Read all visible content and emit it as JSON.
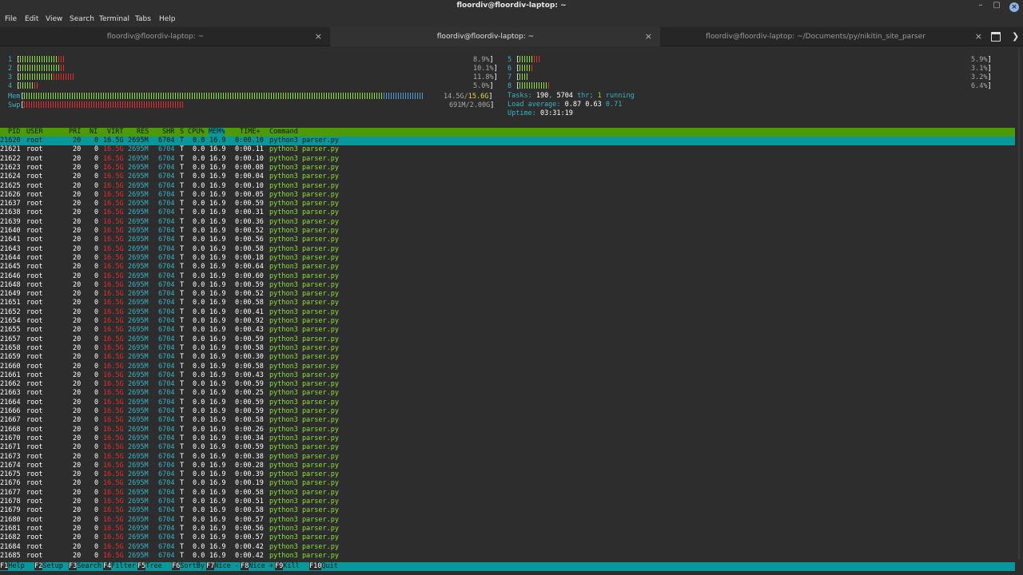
{
  "window": {
    "title": "floordiv@floordiv-laptop: ~",
    "minimize": "–",
    "maximize": "▢",
    "close": "×"
  },
  "menu": [
    "File",
    "Edit",
    "View",
    "Search",
    "Terminal",
    "Tabs",
    "Help"
  ],
  "tabs": [
    {
      "label": "floordiv@floordiv-laptop: ~",
      "close": "×",
      "active": false
    },
    {
      "label": "floordiv@floordiv-laptop: ~",
      "close": "×",
      "active": true
    },
    {
      "label": "floordiv@floordiv-laptop: ~/Documents/py/nikitin_site_parser",
      "close": "×",
      "active": false
    }
  ],
  "htop": {
    "cpus_left": [
      {
        "num": "1",
        "pct": "8.9%",
        "green": 16,
        "red": 3
      },
      {
        "num": "2",
        "pct": "10.1%",
        "green": 17,
        "red": 2
      },
      {
        "num": "3",
        "pct": "11.8%",
        "green": 14,
        "red": 9
      },
      {
        "num": "4",
        "pct": "5.0%",
        "green": 6,
        "red": 2
      }
    ],
    "cpus_right": [
      {
        "num": "5",
        "pct": "5.9%",
        "green": 6,
        "red": 3
      },
      {
        "num": "6",
        "pct": "3.1%",
        "green": 5,
        "red": 1
      },
      {
        "num": "7",
        "pct": "3.2%",
        "green": 4,
        "red": 0
      },
      {
        "num": "8",
        "pct": "6.4%",
        "green": 12,
        "red": 1
      }
    ],
    "mem": {
      "label": "Mem",
      "used": "14.5G",
      "total": "15.6G"
    },
    "swp": {
      "label": "Swp",
      "used": "691M",
      "total": "2.00G"
    },
    "tasks": {
      "label": "Tasks:",
      "count": "190",
      "threads": "5704",
      "thr_label": "thr;",
      "running": "1",
      "running_label": "running"
    },
    "load": {
      "label": "Load average:",
      "l1": "0.87",
      "l5": "0.63",
      "l15": "0.71"
    },
    "uptime": {
      "label": "Uptime:",
      "value": "03:31:19"
    },
    "columns": [
      "PID",
      "USER",
      "PRI",
      "NI",
      "VIRT",
      "RES",
      "SHR",
      "S",
      "CPU%",
      "MEM%",
      "TIME+",
      "Command"
    ],
    "processes": [
      [
        "21620",
        "root",
        "20",
        "0",
        "16.5G",
        "2695M",
        "6704",
        "T",
        "0.0",
        "16.9",
        "0:00.10",
        "python3 parser.py"
      ],
      [
        "21621",
        "root",
        "20",
        "0",
        "16.5G",
        "2695M",
        "6704",
        "T",
        "0.0",
        "16.9",
        "0:00.11",
        "python3 parser.py"
      ],
      [
        "21622",
        "root",
        "20",
        "0",
        "16.5G",
        "2695M",
        "6704",
        "T",
        "0.0",
        "16.9",
        "0:00.10",
        "python3 parser.py"
      ],
      [
        "21623",
        "root",
        "20",
        "0",
        "16.5G",
        "2695M",
        "6704",
        "T",
        "0.0",
        "16.9",
        "0:00.08",
        "python3 parser.py"
      ],
      [
        "21624",
        "root",
        "20",
        "0",
        "16.5G",
        "2695M",
        "6704",
        "T",
        "0.0",
        "16.9",
        "0:00.04",
        "python3 parser.py"
      ],
      [
        "21625",
        "root",
        "20",
        "0",
        "16.5G",
        "2695M",
        "6704",
        "T",
        "0.0",
        "16.9",
        "0:00.10",
        "python3 parser.py"
      ],
      [
        "21626",
        "root",
        "20",
        "0",
        "16.5G",
        "2695M",
        "6704",
        "T",
        "0.0",
        "16.9",
        "0:00.05",
        "python3 parser.py"
      ],
      [
        "21637",
        "root",
        "20",
        "0",
        "16.5G",
        "2695M",
        "6704",
        "T",
        "0.0",
        "16.9",
        "0:00.59",
        "python3 parser.py"
      ],
      [
        "21638",
        "root",
        "20",
        "0",
        "16.5G",
        "2695M",
        "6704",
        "T",
        "0.0",
        "16.9",
        "0:00.31",
        "python3 parser.py"
      ],
      [
        "21639",
        "root",
        "20",
        "0",
        "16.5G",
        "2695M",
        "6704",
        "T",
        "0.0",
        "16.9",
        "0:00.36",
        "python3 parser.py"
      ],
      [
        "21640",
        "root",
        "20",
        "0",
        "16.5G",
        "2695M",
        "6704",
        "T",
        "0.0",
        "16.9",
        "0:00.52",
        "python3 parser.py"
      ],
      [
        "21641",
        "root",
        "20",
        "0",
        "16.5G",
        "2695M",
        "6704",
        "T",
        "0.0",
        "16.9",
        "0:00.56",
        "python3 parser.py"
      ],
      [
        "21643",
        "root",
        "20",
        "0",
        "16.5G",
        "2695M",
        "6704",
        "T",
        "0.0",
        "16.9",
        "0:00.58",
        "python3 parser.py"
      ],
      [
        "21644",
        "root",
        "20",
        "0",
        "16.5G",
        "2695M",
        "6704",
        "T",
        "0.0",
        "16.9",
        "0:00.18",
        "python3 parser.py"
      ],
      [
        "21645",
        "root",
        "20",
        "0",
        "16.5G",
        "2695M",
        "6704",
        "T",
        "0.0",
        "16.9",
        "0:00.64",
        "python3 parser.py"
      ],
      [
        "21646",
        "root",
        "20",
        "0",
        "16.5G",
        "2695M",
        "6704",
        "T",
        "0.0",
        "16.9",
        "0:00.60",
        "python3 parser.py"
      ],
      [
        "21648",
        "root",
        "20",
        "0",
        "16.5G",
        "2695M",
        "6704",
        "T",
        "0.0",
        "16.9",
        "0:00.59",
        "python3 parser.py"
      ],
      [
        "21649",
        "root",
        "20",
        "0",
        "16.5G",
        "2695M",
        "6704",
        "T",
        "0.0",
        "16.9",
        "0:00.52",
        "python3 parser.py"
      ],
      [
        "21651",
        "root",
        "20",
        "0",
        "16.5G",
        "2695M",
        "6704",
        "T",
        "0.0",
        "16.9",
        "0:00.58",
        "python3 parser.py"
      ],
      [
        "21652",
        "root",
        "20",
        "0",
        "16.5G",
        "2695M",
        "6704",
        "T",
        "0.0",
        "16.9",
        "0:00.41",
        "python3 parser.py"
      ],
      [
        "21654",
        "root",
        "20",
        "0",
        "16.5G",
        "2695M",
        "6704",
        "T",
        "0.0",
        "16.9",
        "0:00.92",
        "python3 parser.py"
      ],
      [
        "21655",
        "root",
        "20",
        "0",
        "16.5G",
        "2695M",
        "6704",
        "T",
        "0.0",
        "16.9",
        "0:00.43",
        "python3 parser.py"
      ],
      [
        "21657",
        "root",
        "20",
        "0",
        "16.5G",
        "2695M",
        "6704",
        "T",
        "0.0",
        "16.9",
        "0:00.59",
        "python3 parser.py"
      ],
      [
        "21658",
        "root",
        "20",
        "0",
        "16.5G",
        "2695M",
        "6704",
        "T",
        "0.0",
        "16.9",
        "0:00.58",
        "python3 parser.py"
      ],
      [
        "21659",
        "root",
        "20",
        "0",
        "16.5G",
        "2695M",
        "6704",
        "T",
        "0.0",
        "16.9",
        "0:00.30",
        "python3 parser.py"
      ],
      [
        "21660",
        "root",
        "20",
        "0",
        "16.5G",
        "2695M",
        "6704",
        "T",
        "0.0",
        "16.9",
        "0:00.58",
        "python3 parser.py"
      ],
      [
        "21661",
        "root",
        "20",
        "0",
        "16.5G",
        "2695M",
        "6704",
        "T",
        "0.0",
        "16.9",
        "0:00.43",
        "python3 parser.py"
      ],
      [
        "21662",
        "root",
        "20",
        "0",
        "16.5G",
        "2695M",
        "6704",
        "T",
        "0.0",
        "16.9",
        "0:00.59",
        "python3 parser.py"
      ],
      [
        "21663",
        "root",
        "20",
        "0",
        "16.5G",
        "2695M",
        "6704",
        "T",
        "0.0",
        "16.9",
        "0:00.25",
        "python3 parser.py"
      ],
      [
        "21664",
        "root",
        "20",
        "0",
        "16.5G",
        "2695M",
        "6704",
        "T",
        "0.0",
        "16.9",
        "0:00.59",
        "python3 parser.py"
      ],
      [
        "21666",
        "root",
        "20",
        "0",
        "16.5G",
        "2695M",
        "6704",
        "T",
        "0.0",
        "16.9",
        "0:00.59",
        "python3 parser.py"
      ],
      [
        "21667",
        "root",
        "20",
        "0",
        "16.5G",
        "2695M",
        "6704",
        "T",
        "0.0",
        "16.9",
        "0:00.58",
        "python3 parser.py"
      ],
      [
        "21668",
        "root",
        "20",
        "0",
        "16.5G",
        "2695M",
        "6704",
        "T",
        "0.0",
        "16.9",
        "0:00.26",
        "python3 parser.py"
      ],
      [
        "21670",
        "root",
        "20",
        "0",
        "16.5G",
        "2695M",
        "6704",
        "T",
        "0.0",
        "16.9",
        "0:00.34",
        "python3 parser.py"
      ],
      [
        "21671",
        "root",
        "20",
        "0",
        "16.5G",
        "2695M",
        "6704",
        "T",
        "0.0",
        "16.9",
        "0:00.59",
        "python3 parser.py"
      ],
      [
        "21673",
        "root",
        "20",
        "0",
        "16.5G",
        "2695M",
        "6704",
        "T",
        "0.0",
        "16.9",
        "0:00.38",
        "python3 parser.py"
      ],
      [
        "21674",
        "root",
        "20",
        "0",
        "16.5G",
        "2695M",
        "6704",
        "T",
        "0.0",
        "16.9",
        "0:00.28",
        "python3 parser.py"
      ],
      [
        "21675",
        "root",
        "20",
        "0",
        "16.5G",
        "2695M",
        "6704",
        "T",
        "0.0",
        "16.9",
        "0:00.39",
        "python3 parser.py"
      ],
      [
        "21676",
        "root",
        "20",
        "0",
        "16.5G",
        "2695M",
        "6704",
        "T",
        "0.0",
        "16.9",
        "0:00.19",
        "python3 parser.py"
      ],
      [
        "21677",
        "root",
        "20",
        "0",
        "16.5G",
        "2695M",
        "6704",
        "T",
        "0.0",
        "16.9",
        "0:00.58",
        "python3 parser.py"
      ],
      [
        "21678",
        "root",
        "20",
        "0",
        "16.5G",
        "2695M",
        "6704",
        "T",
        "0.0",
        "16.9",
        "0:00.51",
        "python3 parser.py"
      ],
      [
        "21679",
        "root",
        "20",
        "0",
        "16.5G",
        "2695M",
        "6704",
        "T",
        "0.0",
        "16.9",
        "0:00.58",
        "python3 parser.py"
      ],
      [
        "21680",
        "root",
        "20",
        "0",
        "16.5G",
        "2695M",
        "6704",
        "T",
        "0.0",
        "16.9",
        "0:00.57",
        "python3 parser.py"
      ],
      [
        "21681",
        "root",
        "20",
        "0",
        "16.5G",
        "2695M",
        "6704",
        "T",
        "0.0",
        "16.9",
        "0:00.56",
        "python3 parser.py"
      ],
      [
        "21682",
        "root",
        "20",
        "0",
        "16.5G",
        "2695M",
        "6704",
        "T",
        "0.0",
        "16.9",
        "0:00.57",
        "python3 parser.py"
      ],
      [
        "21684",
        "root",
        "20",
        "0",
        "16.5G",
        "2695M",
        "6704",
        "T",
        "0.0",
        "16.9",
        "0:00.42",
        "python3 parser.py"
      ],
      [
        "21685",
        "root",
        "20",
        "0",
        "16.5G",
        "2695M",
        "6704",
        "T",
        "0.0",
        "16.9",
        "0:00.42",
        "python3 parser.py"
      ]
    ],
    "fkeys": [
      {
        "key": "F1",
        "label": "Help"
      },
      {
        "key": "F2",
        "label": "Setup"
      },
      {
        "key": "F3",
        "label": "Search"
      },
      {
        "key": "F4",
        "label": "Filter"
      },
      {
        "key": "F5",
        "label": "Tree"
      },
      {
        "key": "F6",
        "label": "SortBy"
      },
      {
        "key": "F7",
        "label": "Nice -"
      },
      {
        "key": "F8",
        "label": "Nice +"
      },
      {
        "key": "F9",
        "label": "Kill"
      },
      {
        "key": "F10",
        "label": "Quit"
      }
    ]
  },
  "colors": {
    "header_green": "#4e9a06",
    "selection_cyan": "#06989a",
    "text_green": "#8ae234",
    "text_red": "#ef2929",
    "text_cyan": "#34b4c4",
    "close_blue": "#8cb4e8"
  }
}
